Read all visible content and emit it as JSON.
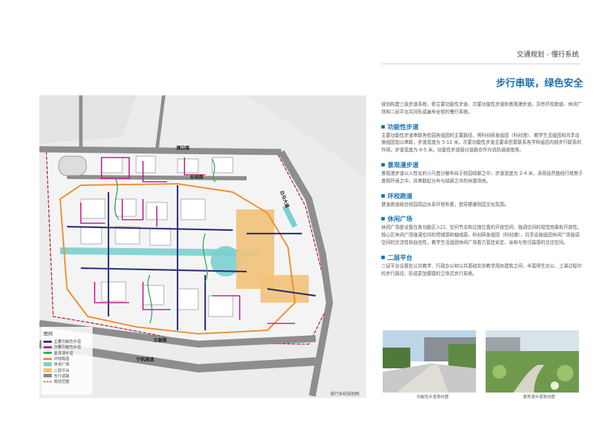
{
  "header": {
    "title": "交通规划 - 慢行系统"
  },
  "main": {
    "heading": "步行串联，绿色安全",
    "intro": "规划构建三级步道系统，即主要功能性步道、次要功能性步道和景观漫步道，另有环校跑道、休闲广场和二层平台共同形成遍布全校的慢行系统。",
    "sections": [
      {
        "title": "功能性步道",
        "body": "主要功能性步道串联各校园各组团的主要路径，将科创研发组团（科创港）、教学生活组团和共享设施组团加以串联，步道宽度为 5-12 米。次要功能性步道主要承担着联系各学科组团内部步行联系的作用，步道宽度为 4-5 米。功能性步道部分道路亦作为消防通道使用。"
      },
      {
        "title": "景观漫步道",
        "body": "景观漫步道以人性化的小尺度分散布局于校园绿廊之中，步道宽度为 2-4 米，采用自然曲线行就势于景观环境之中，并串联起分布与绿廊之中的休憩场地。"
      },
      {
        "title": "环校跑道",
        "body": "健身跑道结合校园周边水系环校布置，倡导健康校园文化氛围。"
      },
      {
        "title": "休闲广场",
        "body": "休闲广场是设置在各功能区入口、空间节点和过渡位置的开放空间，强调空间的视觉效果和开放性。核心区休闲广场强调空间的领域感和轴线感，科创研发组团（科创港），共享设施组团休闲广场强调空间的交流性和自由性，教学生活组团休闲广场着力营造安定、亲和与有归属感的交往空间。"
      },
      {
        "title": "二层平台",
        "body": "二层平台设置在公共教学、行政办公和公共基础实验教学用房建筑之间，丰富师生办公、上课过程中的步行路径，形成更加便捷的立体式步行系统。"
      }
    ]
  },
  "map": {
    "caption": "慢行系统规划图",
    "roads": {
      "north": "溧白路",
      "middle": "谷雨路",
      "east": "白马大道",
      "south1": "立春路",
      "south2": "宁杭高速"
    },
    "legend": {
      "title": "图例",
      "items": [
        {
          "label": "主要功能性步道",
          "color": "#2b2f7a"
        },
        {
          "label": "次要功能性步道",
          "color": "#c2198c"
        },
        {
          "label": "景观漫步道",
          "color": "#3aa85a"
        },
        {
          "label": "环校跑道",
          "color": "#f08c2a"
        },
        {
          "label": "休闲广场",
          "color": "#7ccfcf"
        },
        {
          "label": "二层平台",
          "color": "#f2c27a"
        },
        {
          "label": "车行道路",
          "color": "#8a8a8a"
        },
        {
          "label": "规划范围",
          "color": "#b5121b"
        }
      ]
    }
  },
  "photos": [
    {
      "caption": "功能性步道意向图"
    },
    {
      "caption": "景观漫步道意向图"
    }
  ]
}
